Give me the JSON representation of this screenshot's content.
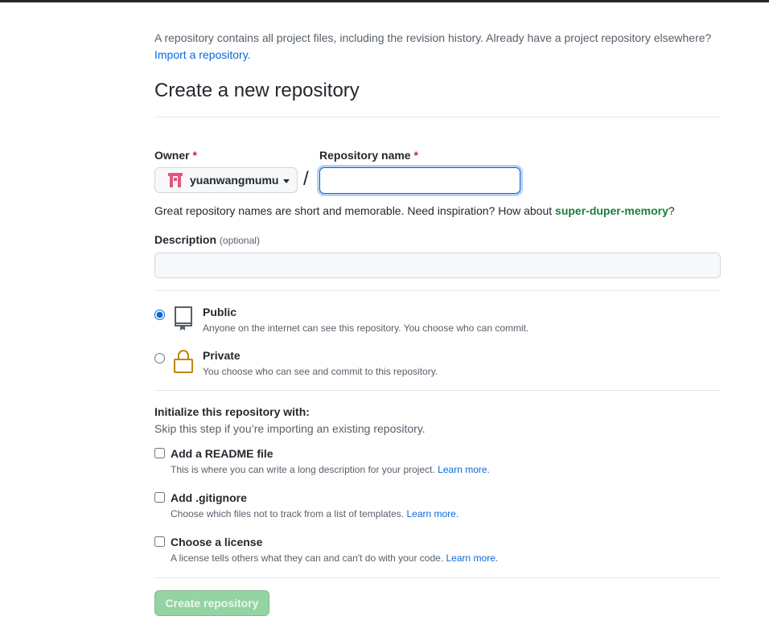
{
  "intro": {
    "text": "A repository contains all project files, including the revision history. Already have a project repository elsewhere?",
    "import_link": "Import a repository."
  },
  "page_title": "Create a new repository",
  "owner": {
    "label": "Owner",
    "required_mark": "*",
    "name": "yuanwangmumu",
    "avatar_icon": "identicon-avatar",
    "avatar_color": "#e5567a"
  },
  "separator": "/",
  "repo_name": {
    "label": "Repository name",
    "required_mark": "*",
    "value": ""
  },
  "name_hint": {
    "text": "Great repository names are short and memorable. Need inspiration? How about",
    "suggestion": "super-duper-memory",
    "suffix": "?"
  },
  "description": {
    "label": "Description",
    "optional": "(optional)",
    "value": ""
  },
  "visibility": {
    "options": [
      {
        "title": "Public",
        "note": "Anyone on the internet can see this repository. You choose who can commit.",
        "icon": "repo-book-icon",
        "selected": true
      },
      {
        "title": "Private",
        "note": "You choose who can see and commit to this repository.",
        "icon": "lock-icon",
        "selected": false
      }
    ]
  },
  "initialize": {
    "title": "Initialize this repository with:",
    "subtitle": "Skip this step if you’re importing an existing repository.",
    "options": [
      {
        "label": "Add a README file",
        "note": "This is where you can write a long description for your project.",
        "link": "Learn more.",
        "checked": false
      },
      {
        "label": "Add .gitignore",
        "note": "Choose which files not to track from a list of templates.",
        "link": "Learn more.",
        "checked": false
      },
      {
        "label": "Choose a license",
        "note": "A license tells others what they can and can't do with your code.",
        "link": "Learn more.",
        "checked": false
      }
    ]
  },
  "create_button": "Create repository",
  "colors": {
    "link": "#0969da",
    "suggestion": "#1a7f37",
    "required": "#cf222e",
    "lock": "#bf8700",
    "button_disabled": "#94d3a2"
  }
}
